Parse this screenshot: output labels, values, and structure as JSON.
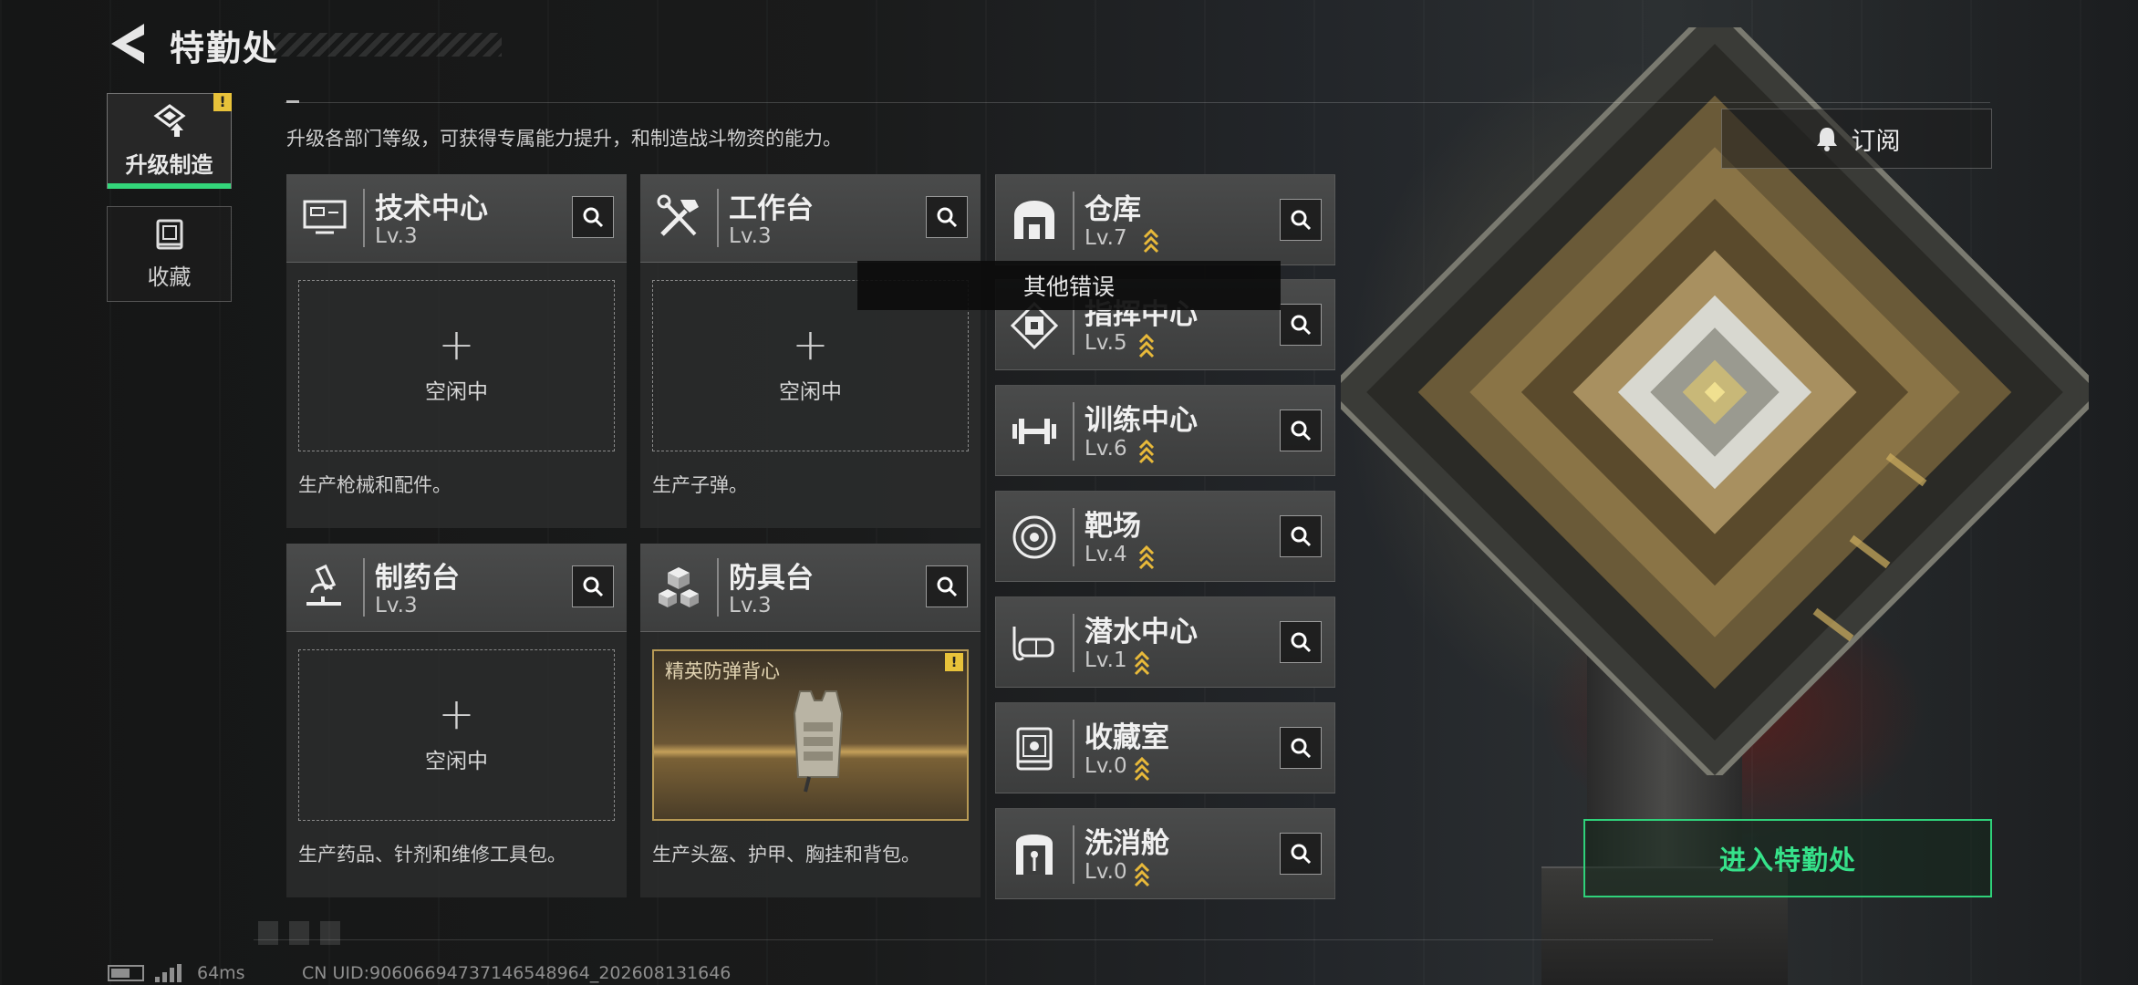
{
  "header": {
    "title": "特勤处"
  },
  "side_tabs": [
    {
      "label": "升级制造",
      "active": true,
      "badge": "!"
    },
    {
      "label": "收藏",
      "active": false
    }
  ],
  "description": "升级各部门等级，可获得专属能力提升，和制造战斗物资的能力。",
  "subscribe_label": "订阅",
  "workstations": [
    {
      "name": "技术中心",
      "level": "Lv.3",
      "slot_label": "空闲中",
      "product_desc": "生产枪械和配件。"
    },
    {
      "name": "工作台",
      "level": "Lv.3",
      "slot_label": "空闲中",
      "product_desc": "生产子弹。"
    },
    {
      "name": "制药台",
      "level": "Lv.3",
      "slot_label": "空闲中",
      "product_desc": "生产药品、针剂和维修工具包。"
    },
    {
      "name": "防具台",
      "level": "Lv.3",
      "slot_item": "精英防弹背心",
      "slot_badge": "!",
      "product_desc": "生产头盔、护甲、胸挂和背包。"
    }
  ],
  "facilities": [
    {
      "name": "仓库",
      "level": "Lv.7",
      "upgradable": true
    },
    {
      "name": "指挥中心",
      "level": "Lv.5",
      "upgradable": true
    },
    {
      "name": "训练中心",
      "level": "Lv.6",
      "upgradable": true
    },
    {
      "name": "靶场",
      "level": "Lv.4",
      "upgradable": true
    },
    {
      "name": "潜水中心",
      "level": "Lv.1",
      "upgradable": true
    },
    {
      "name": "收藏室",
      "level": "Lv.0",
      "upgradable": true
    },
    {
      "name": "洗消舱",
      "level": "Lv.0",
      "upgradable": true
    }
  ],
  "tooltip": "其他错误",
  "enter_button": "进入特勤处",
  "status_bar": {
    "ping": "64ms",
    "uid": "CN UID:906066947371465489­64_202608131646"
  },
  "colors": {
    "accent_green": "#2fd27a",
    "upgrade_gold": "#e8b93a",
    "warning_yellow": "#e8c23a"
  },
  "icons": {
    "back": "chevron-left-icon",
    "upgrade_tab": "upgrade-craft-icon",
    "collection_tab": "collection-icon",
    "subscribe": "bell-icon",
    "search": "magnifier-icon",
    "upgrade_arrow": "double-chevron-up-icon"
  }
}
